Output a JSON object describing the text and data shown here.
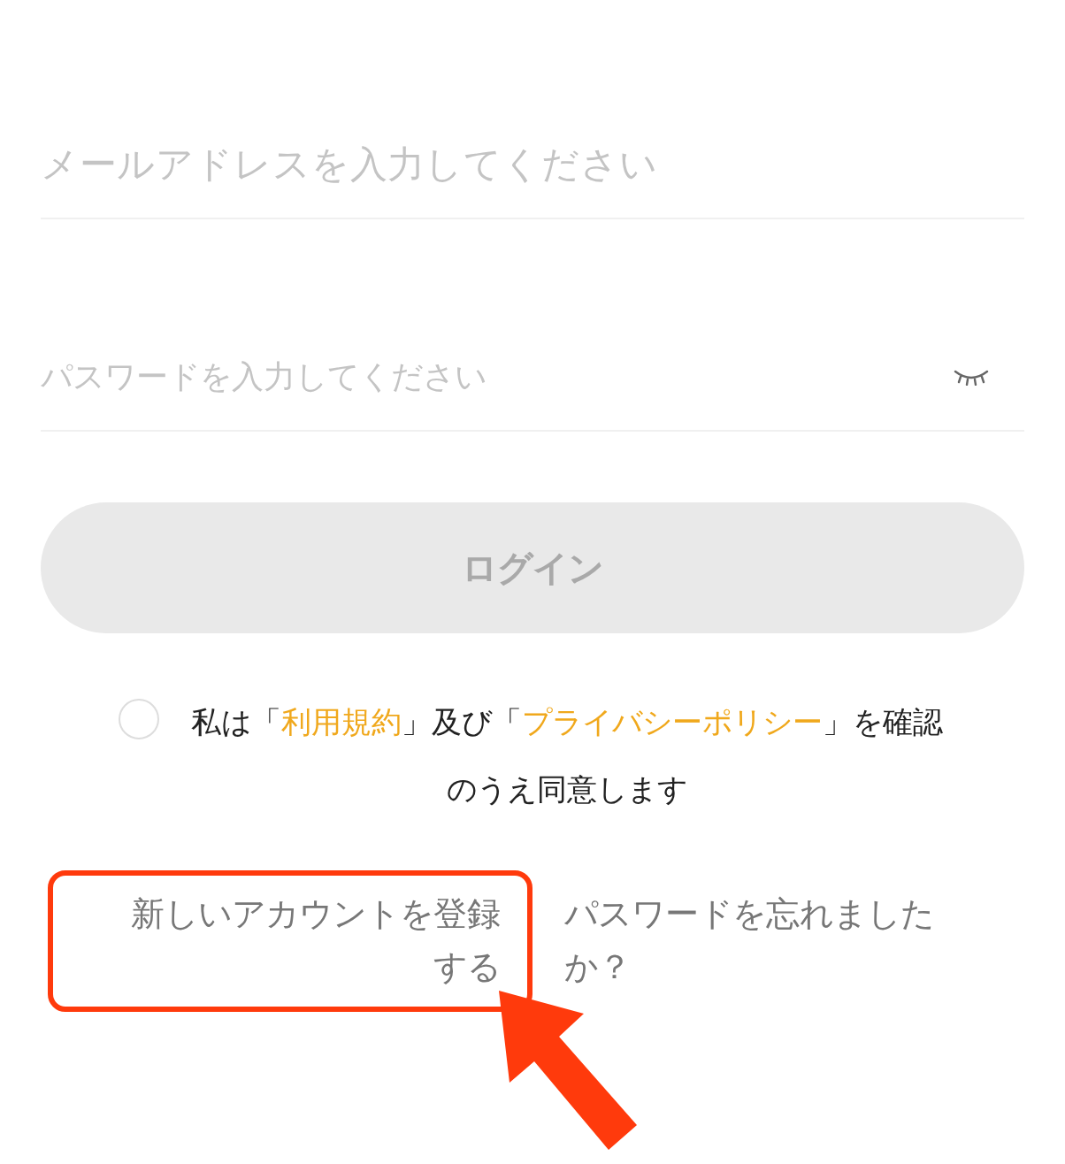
{
  "email_field": {
    "placeholder": "メールアドレスを入力してください"
  },
  "password_field": {
    "placeholder": "パスワードを入力してください",
    "visible": false
  },
  "login_button": {
    "label": "ログイン",
    "disabled": true
  },
  "agreement": {
    "checked": false,
    "segments": [
      {
        "kind": "text",
        "text": "私は「"
      },
      {
        "kind": "link",
        "text": "利用規約"
      },
      {
        "kind": "text",
        "text": "」及び「"
      },
      {
        "kind": "link",
        "text": "プライバシーポリシー"
      },
      {
        "kind": "text",
        "text": "」を確認のうえ同意します"
      }
    ]
  },
  "links": [
    {
      "label": "新しいアカウントを登録する",
      "highlighted": true
    },
    {
      "label": "パスワードを忘れましたか？",
      "highlighted": false
    }
  ],
  "annotations": [
    {
      "kind": "arrow"
    }
  ]
}
